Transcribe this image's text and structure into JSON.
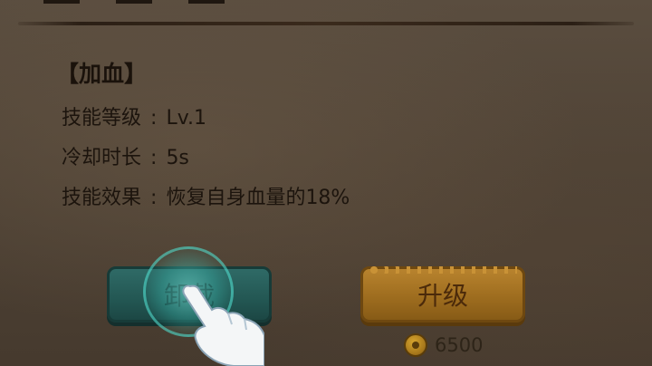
{
  "skill": {
    "name": "【加血】",
    "details": [
      {
        "label": "技能等级",
        "sep": ":",
        "value": "Lv.1"
      },
      {
        "label": "冷却时长",
        "sep": ":",
        "value": "5s"
      },
      {
        "label": "技能效果",
        "sep": ":",
        "value": "恢复自身血量的18%"
      }
    ]
  },
  "buttons": {
    "unload_label": "卸载",
    "upgrade_label": "升级"
  },
  "cost": {
    "icon": "coin-icon",
    "value": "6500"
  },
  "colors": {
    "unload_button": "#2f6a66",
    "upgrade_button": "#b8832e",
    "tap_highlight": "#50dccd"
  }
}
